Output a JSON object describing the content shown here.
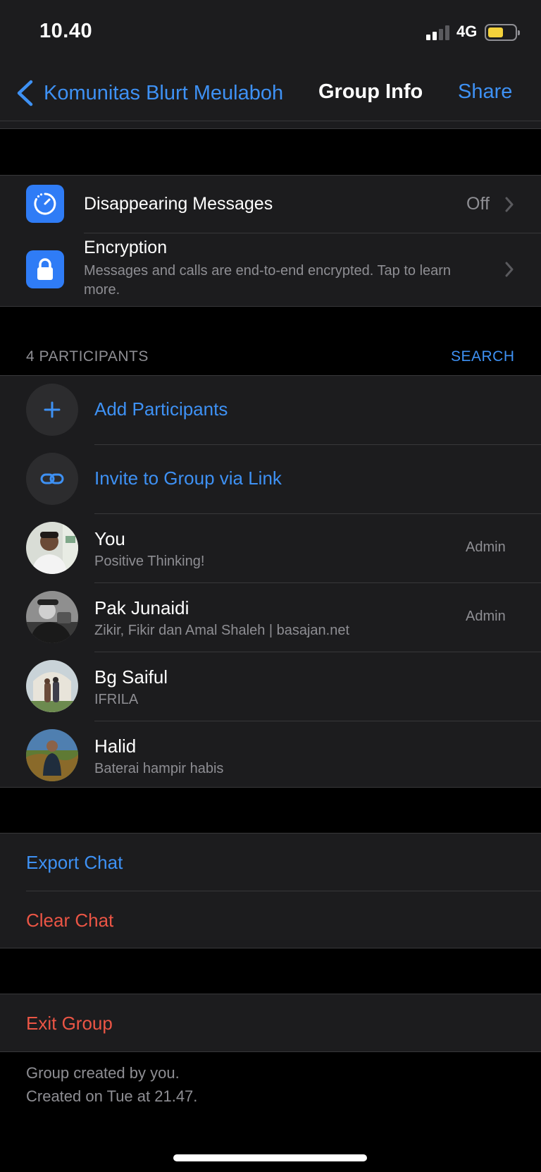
{
  "status_bar": {
    "time": "10.40",
    "network": "4G"
  },
  "nav": {
    "back_label": "Komunitas Blurt Meulaboh",
    "title": "Group Info",
    "share_label": "Share"
  },
  "settings": {
    "disappearing": {
      "label": "Disappearing Messages",
      "value": "Off",
      "icon": "timer-icon"
    },
    "encryption": {
      "label": "Encryption",
      "description": "Messages and calls are end-to-end encrypted. Tap to learn more.",
      "icon": "lock-icon"
    }
  },
  "participants": {
    "count_label": "4 PARTICIPANTS",
    "search_label": "SEARCH",
    "add_label": "Add Participants",
    "invite_label": "Invite to Group via Link",
    "members": [
      {
        "name": "You",
        "status": "Positive Thinking!",
        "role": "Admin"
      },
      {
        "name": "Pak Junaidi",
        "status": "Zikir, Fikir dan Amal Shaleh | basajan.net",
        "role": "Admin"
      },
      {
        "name": "Bg Saiful",
        "status": "IFRILA",
        "role": ""
      },
      {
        "name": "Halid",
        "status": "Baterai hampir habis",
        "role": ""
      }
    ]
  },
  "chat_actions": {
    "export": "Export Chat",
    "clear": "Clear Chat",
    "exit": "Exit Group"
  },
  "footer": {
    "created_by": "Group created by you.",
    "created_on": "Created on Tue at 21.47."
  },
  "colors": {
    "accent": "#3e91f4",
    "destructive": "#eb5545",
    "secondary_text": "#8e8e93",
    "cell_background": "#1c1c1e",
    "battery": "#f4d23b"
  }
}
